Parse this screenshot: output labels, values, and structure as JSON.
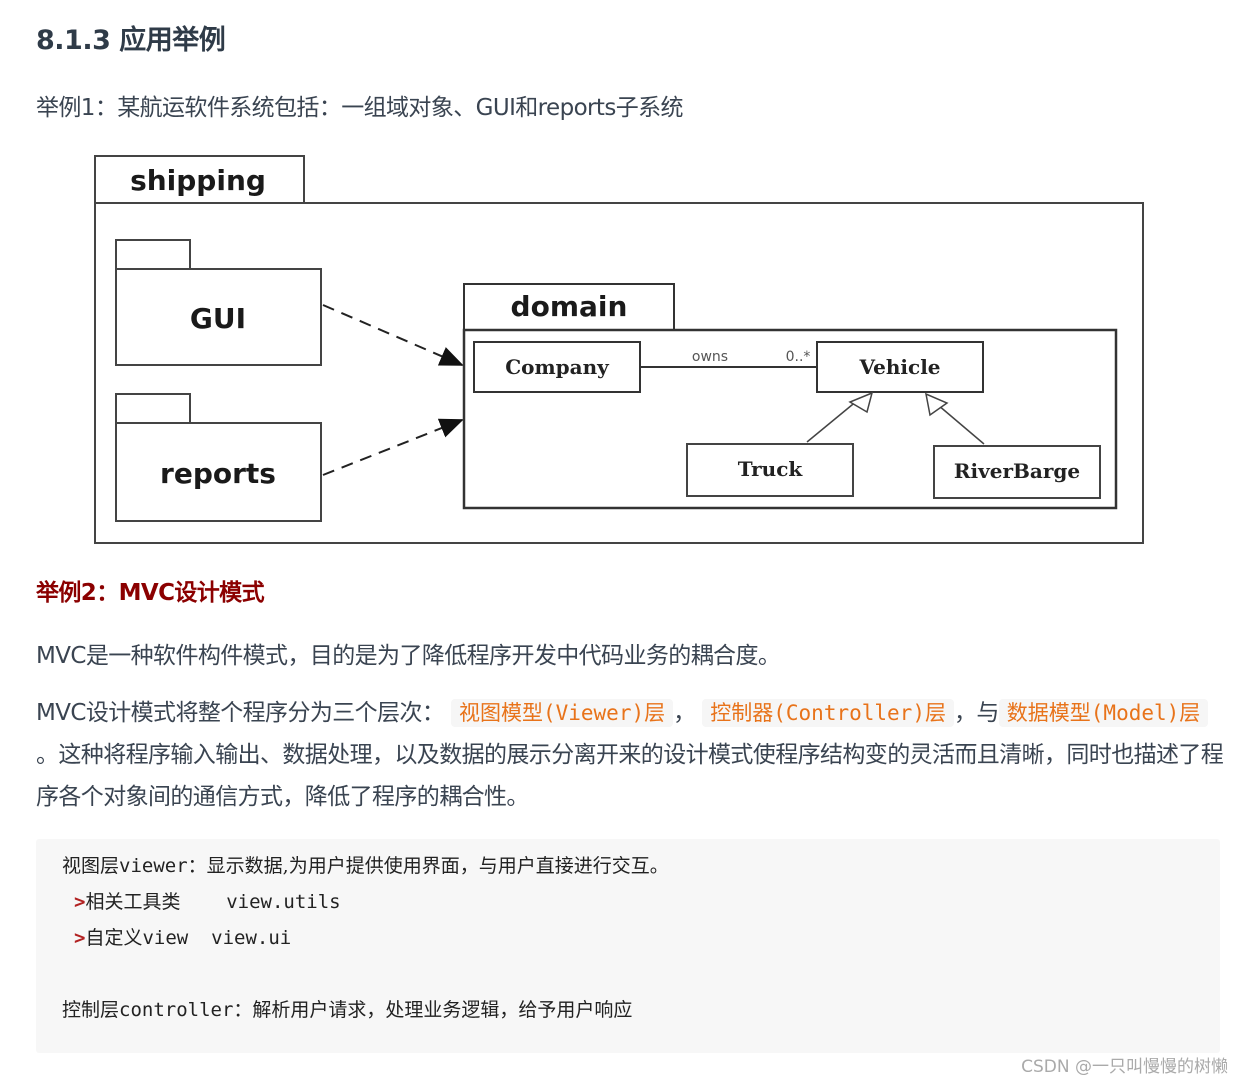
{
  "section": {
    "title": "8.1.3 应用举例"
  },
  "example1": {
    "text": "举例1：某航运软件系统包括：一组域对象、GUI和reports子系统"
  },
  "diagram": {
    "outer_package": "shipping",
    "packages": [
      "GUI",
      "reports"
    ],
    "domain_package": "domain",
    "classes": {
      "company": "Company",
      "vehicle": "Vehicle",
      "truck": "Truck",
      "riverbarge": "RiverBarge"
    },
    "association": {
      "label": "owns",
      "multiplicity": "0..*"
    }
  },
  "example2": {
    "heading": "举例2：MVC设计模式",
    "intro": "MVC是一种软件构件模式，目的是为了降低程序开发中代码业务的耦合度。",
    "p_prefix": "MVC设计模式将整个程序分为三个层次：",
    "layer_viewer": "视图模型(Viewer)层",
    "sep1": "，",
    "layer_controller": "控制器(Controller)层",
    "sep2": "，与",
    "layer_model": "数据模型(Model)层",
    "p_suffix": "。这种将程序输入输出、数据处理，以及数据的展示分离开来的设计模式使程序结构变的灵活而且清晰，同时也描述了程序各个对象间的通信方式，降低了程序的耦合性。"
  },
  "code_block": {
    "line1_label": "视图层",
    "line1_code": "viewer",
    "line1_text": "：显示数据,为用户提供使用界面，与用户直接进行交互。",
    "line2_marker": ">",
    "line2_label": "相关工具类",
    "line2_code": "view.utils",
    "line3_marker": ">",
    "line3_label": "自定义",
    "line3_inline": "view",
    "line3_code": "view.ui",
    "line4_label": "控制层",
    "line4_code": "controller",
    "line4_text": "：解析用户请求，处理业务逻辑，给予用户响应"
  },
  "watermark": "CSDN @一只叫慢慢的树懒"
}
